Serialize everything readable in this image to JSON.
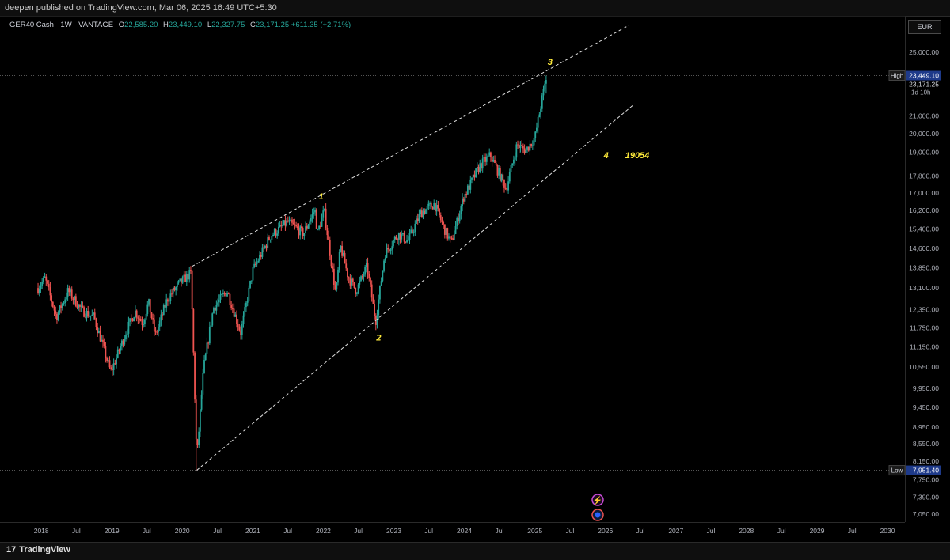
{
  "header": {
    "published": "deepen published on TradingView.com, Mar 06, 2025 16:49 UTC+5:30"
  },
  "legend": {
    "symbol": "GER40 Cash · 1W · VANTAGE",
    "open_label": "O",
    "open": "22,585.20",
    "high_label": "H",
    "high": "23,449.10",
    "low_label": "L",
    "low": "22,327.75",
    "close_label": "C",
    "close": "23,171.25",
    "change": "+611.35 (+2.71%)"
  },
  "currency": "EUR",
  "footer": {
    "logo_text": "TradingView",
    "logo_mark": "17"
  },
  "colors": {
    "up": "#26a69a",
    "down": "#ef5350",
    "wave_label": "#ffeb3b",
    "background": "#000000",
    "price_tag": "#1e3a8a",
    "event_icon_1": "#c84bd6",
    "event_icon_2": "#2962ff"
  },
  "chart_data": {
    "type": "candlestick",
    "y_scale": "log",
    "ylim": [
      6900,
      27500
    ],
    "xlim": [
      "2017-06-01",
      "2030-04-01"
    ],
    "x_ticks": [
      "2018",
      "Jul",
      "2019",
      "Jul",
      "2020",
      "Jul",
      "2021",
      "Jul",
      "2022",
      "Jul",
      "2023",
      "Jul",
      "2024",
      "Jul",
      "2025",
      "Jul",
      "2026",
      "Jul",
      "2027",
      "Jul",
      "2028",
      "Jul",
      "2029",
      "Jul",
      "2030"
    ],
    "x_tick_dates": [
      "2018-01-01",
      "2018-07-01",
      "2019-01-01",
      "2019-07-01",
      "2020-01-01",
      "2020-07-01",
      "2021-01-01",
      "2021-07-01",
      "2022-01-01",
      "2022-07-01",
      "2023-01-01",
      "2023-07-01",
      "2024-01-01",
      "2024-07-01",
      "2025-01-01",
      "2025-07-01",
      "2026-01-01",
      "2026-07-01",
      "2027-01-01",
      "2027-07-01",
      "2028-01-01",
      "2028-07-01",
      "2029-01-01",
      "2029-07-01",
      "2030-01-01"
    ],
    "y_ticks": [
      "25,000.00",
      "21,000.00",
      "20,000.00",
      "19,000.00",
      "17,800.00",
      "17,000.00",
      "16,200.00",
      "15,400.00",
      "14,600.00",
      "13,850.00",
      "13,100.00",
      "12,350.00",
      "11,750.00",
      "11,150.00",
      "10,550.00",
      "9,950.00",
      "9,450.00",
      "8,950.00",
      "8,550.00",
      "8,150.00",
      "7,750.00",
      "7,390.00",
      "7,050.00"
    ],
    "high_marker": {
      "label": "High",
      "value": "23,449.10",
      "last": "23,171.25",
      "countdown": "1d 10h"
    },
    "low_marker": {
      "label": "Low",
      "value": "7,951.40"
    },
    "path": [
      [
        "2017-12-15",
        13100
      ],
      [
        "2018-01-20",
        13450
      ],
      [
        "2018-03-20",
        12100
      ],
      [
        "2018-05-20",
        13000
      ],
      [
        "2018-08-01",
        12300
      ],
      [
        "2018-10-01",
        12100
      ],
      [
        "2018-12-27",
        10400
      ],
      [
        "2019-03-15",
        11600
      ],
      [
        "2019-05-01",
        12300
      ],
      [
        "2019-06-10",
        11900
      ],
      [
        "2019-07-10",
        12600
      ],
      [
        "2019-08-15",
        11500
      ],
      [
        "2019-10-15",
        12700
      ],
      [
        "2019-12-15",
        13250
      ],
      [
        "2020-02-15",
        13650
      ],
      [
        "2020-03-16",
        8200
      ],
      [
        "2020-04-20",
        10500
      ],
      [
        "2020-06-10",
        12400
      ],
      [
        "2020-08-20",
        13000
      ],
      [
        "2020-10-30",
        11600
      ],
      [
        "2021-01-01",
        13750
      ],
      [
        "2021-04-01",
        15100
      ],
      [
        "2021-07-01",
        15700
      ],
      [
        "2021-09-20",
        15200
      ],
      [
        "2021-11-18",
        16250
      ],
      [
        "2021-12-01",
        15200
      ],
      [
        "2022-01-05",
        16200
      ],
      [
        "2022-03-07",
        12850
      ],
      [
        "2022-03-30",
        14700
      ],
      [
        "2022-05-10",
        13500
      ],
      [
        "2022-06-20",
        13000
      ],
      [
        "2022-08-15",
        13900
      ],
      [
        "2022-09-29",
        11950
      ],
      [
        "2022-11-15",
        14400
      ],
      [
        "2023-01-25",
        15200
      ],
      [
        "2023-03-15",
        14900
      ],
      [
        "2023-05-20",
        16100
      ],
      [
        "2023-07-30",
        16500
      ],
      [
        "2023-09-20",
        15400
      ],
      [
        "2023-10-25",
        14800
      ],
      [
        "2023-12-28",
        16800
      ],
      [
        "2024-03-20",
        18300
      ],
      [
        "2024-05-15",
        18850
      ],
      [
        "2024-06-20",
        18100
      ],
      [
        "2024-08-05",
        17200
      ],
      [
        "2024-09-30",
        19400
      ],
      [
        "2024-11-15",
        19100
      ],
      [
        "2025-01-01",
        19800
      ],
      [
        "2025-02-15",
        22500
      ],
      [
        "2025-03-04",
        23449
      ]
    ],
    "lows": [
      [
        "2020-03-16",
        7951.4
      ]
    ],
    "trendlines": [
      {
        "name": "upper",
        "from": [
          "2020-02-20",
          13900
        ],
        "to": [
          "2026-05-01",
          26900
        ]
      },
      {
        "name": "lower",
        "from": [
          "2020-03-16",
          7951.4
        ],
        "to": [
          "2026-06-01",
          21700
        ]
      }
    ],
    "wave_labels": [
      {
        "text": "1",
        "at": [
          "2021-12-20",
          16700
        ]
      },
      {
        "text": "2",
        "at": [
          "2022-10-15",
          11350
        ]
      },
      {
        "text": "3",
        "at": [
          "2025-03-20",
          24150
        ]
      },
      {
        "text": "4",
        "at": [
          "2026-01-05",
          18700
        ]
      },
      {
        "text": "19054",
        "at": [
          "2026-06-15",
          18700
        ]
      }
    ]
  }
}
